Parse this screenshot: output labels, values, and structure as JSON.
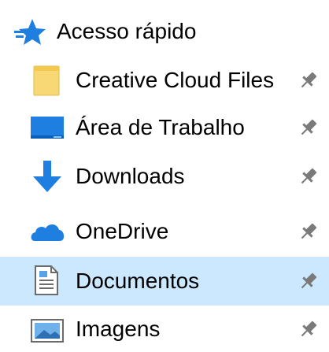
{
  "quick_access": {
    "label": "Acesso rápido",
    "icon": "star-icon",
    "color": "#1f7fe0"
  },
  "items": [
    {
      "label": "Creative Cloud Files",
      "icon": "folder-icon",
      "pinned": true,
      "selected": false
    },
    {
      "label": "Área de Trabalho",
      "icon": "desktop-icon",
      "pinned": true,
      "selected": false
    },
    {
      "label": "Downloads",
      "icon": "download-arrow-icon",
      "pinned": true,
      "selected": false
    },
    {
      "label": "OneDrive",
      "icon": "onedrive-cloud-icon",
      "pinned": true,
      "selected": false
    },
    {
      "label": "Documentos",
      "icon": "document-icon",
      "pinned": true,
      "selected": true
    },
    {
      "label": "Imagens",
      "icon": "pictures-icon",
      "pinned": true,
      "selected": false
    }
  ],
  "colors": {
    "selection": "#cce8ff",
    "accent": "#1f7fe0",
    "folder": "#f8d775",
    "pin": "#7a7a7a"
  }
}
